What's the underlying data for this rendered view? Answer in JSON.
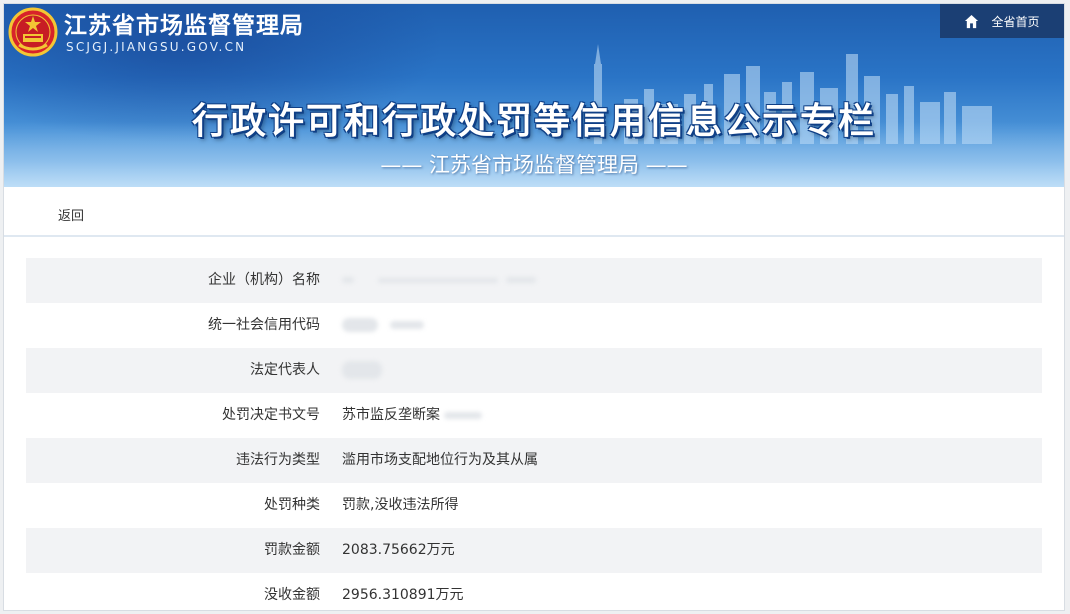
{
  "header": {
    "site_name": "江苏省市场监督管理局",
    "site_url": "SCJGJ.JIANGSU.GOV.CN",
    "home_label": "全省首页",
    "banner_title": "行政许可和行政处罚等信用信息公示专栏",
    "banner_subtitle": "—— 江苏省市场监督管理局 ——",
    "colors": {
      "banner_blue": "#2a74c6",
      "home_button": "#1b3f74"
    }
  },
  "nav": {
    "back_label": "返回"
  },
  "record": {
    "rows": [
      {
        "label": "企业（机构）名称",
        "value": "",
        "redacted": true
      },
      {
        "label": "统一社会信用代码",
        "value": "",
        "redacted": true
      },
      {
        "label": "法定代表人",
        "value": "",
        "redacted": true
      },
      {
        "label": "处罚决定书文号",
        "value": "苏市监反垄断案"
      },
      {
        "label": "违法行为类型",
        "value": "滥用市场支配地位行为及其从属"
      },
      {
        "label": "处罚种类",
        "value": "罚款,没收违法所得"
      },
      {
        "label": "罚款金额",
        "value": "2083.75662万元"
      },
      {
        "label": "没收金额",
        "value": "2956.310891万元"
      }
    ]
  },
  "icons": [
    "national-emblem-icon",
    "home-icon",
    "city-skyline-image"
  ]
}
